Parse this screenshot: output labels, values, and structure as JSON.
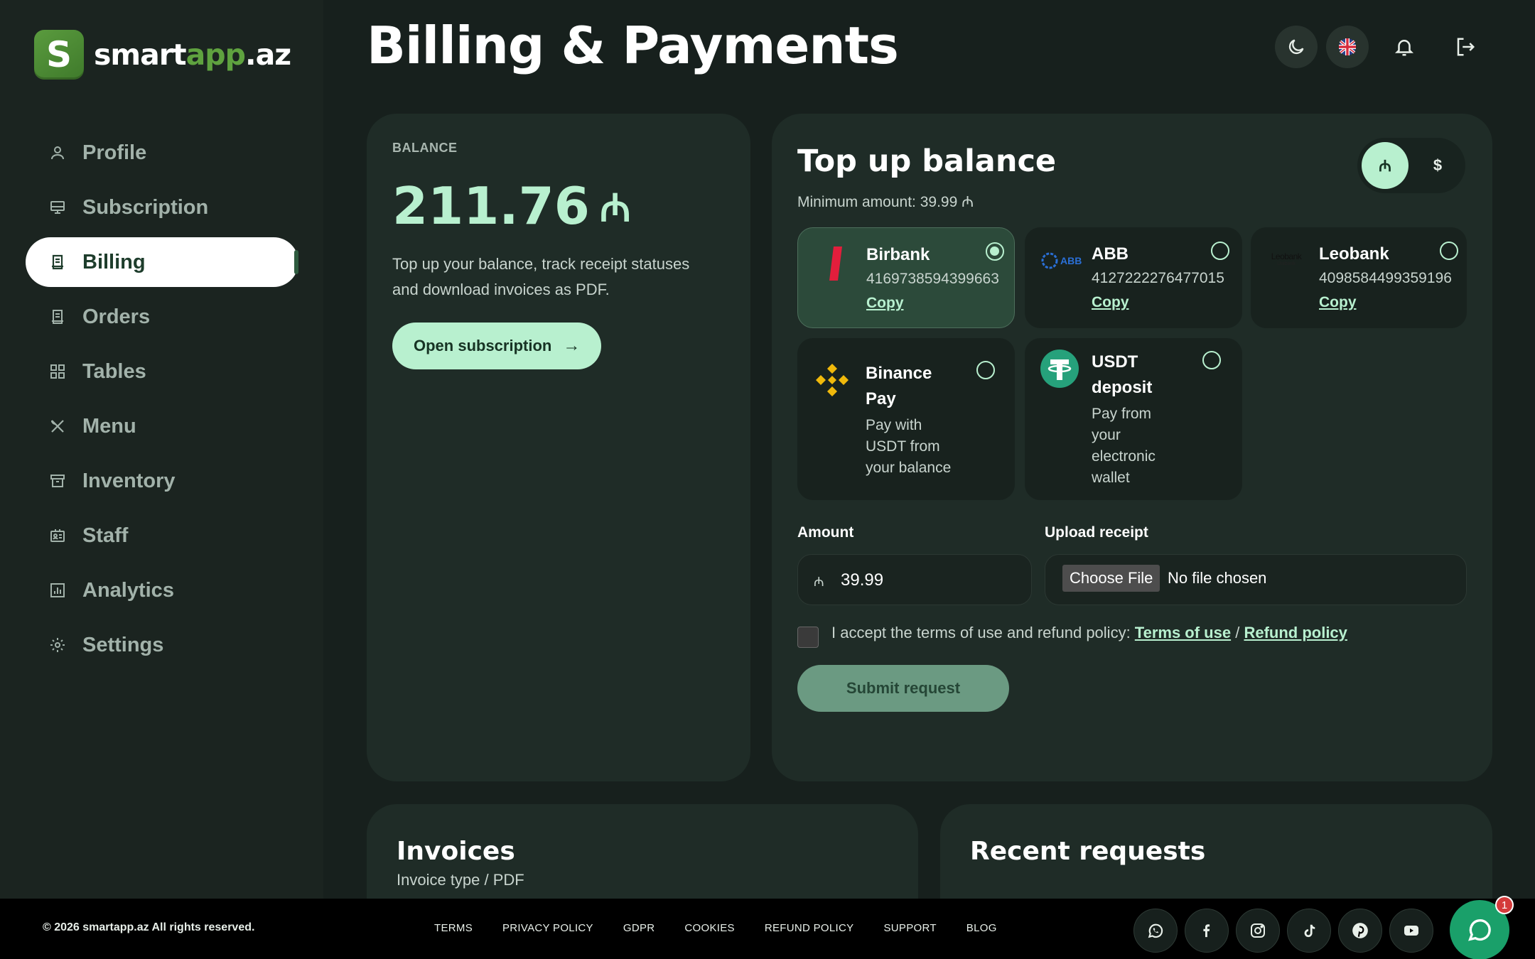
{
  "brand": {
    "name_main": "smart",
    "name_accent": "app",
    "name_suffix": ".az",
    "mark_letter": "S",
    "color_accent": "#5fa23f"
  },
  "sidebar": {
    "items": [
      {
        "label": "Profile",
        "icon": "user-icon"
      },
      {
        "label": "Subscription",
        "icon": "monitor-icon"
      },
      {
        "label": "Billing",
        "icon": "receipt-icon",
        "active": true
      },
      {
        "label": "Orders",
        "icon": "clipboard-icon"
      },
      {
        "label": "Tables",
        "icon": "grid-icon"
      },
      {
        "label": "Menu",
        "icon": "utensils-icon"
      },
      {
        "label": "Inventory",
        "icon": "archive-icon"
      },
      {
        "label": "Staff",
        "icon": "id-card-icon"
      },
      {
        "label": "Analytics",
        "icon": "bar-chart-icon"
      },
      {
        "label": "Settings",
        "icon": "gear-icon"
      }
    ]
  },
  "header": {
    "title": "Billing & Payments"
  },
  "balance": {
    "label": "BALANCE",
    "amount": "211.76",
    "currency": "₼",
    "description": "Top up your balance, track receipt statuses and download invoices as PDF.",
    "open_button": "Open subscription"
  },
  "topup": {
    "title": "Top up balance",
    "minimum": "Minimum amount: 39.99 ₼",
    "currency_options": [
      "₼",
      "$"
    ],
    "methods": [
      {
        "name": "Birbank",
        "number": "4169738594399663",
        "copy": "Copy",
        "selected": true
      },
      {
        "name": "ABB",
        "number": "4127222276477015",
        "copy": "Copy",
        "logo_text": "ABB"
      },
      {
        "name": "Leobank",
        "number": "4098584499359196",
        "copy": "Copy",
        "logo_text": "Leobank",
        "logo_sub": "Unibank"
      },
      {
        "name_line1": "Binance",
        "name_line2": "Pay",
        "desc_lines": [
          "Pay with",
          "USDT from",
          "your balance"
        ]
      },
      {
        "name_line1": "USDT",
        "name_line2": "deposit",
        "desc_lines": [
          "Pay from",
          "your",
          "electronic",
          "wallet"
        ]
      }
    ],
    "amount_label": "Amount",
    "amount_currency": "₼",
    "amount_value": "39.99",
    "upload_label": "Upload receipt",
    "choose_file": "Choose File",
    "no_file": "No file chosen",
    "terms_text": "I accept the terms of use and refund policy: ",
    "terms_link": "Terms of use",
    "terms_sep": " / ",
    "refund_link": "Refund policy",
    "submit": "Submit request"
  },
  "invoices": {
    "title": "Invoices",
    "subtitle": "Invoice type / PDF"
  },
  "requests": {
    "title": "Recent requests"
  },
  "footer": {
    "copyright": "© 2026 smartapp.az All rights reserved.",
    "links": [
      "TERMS",
      "PRIVACY POLICY",
      "GDPR",
      "COOKIES",
      "REFUND POLICY",
      "SUPPORT",
      "BLOG"
    ],
    "social": [
      "whatsapp-icon",
      "facebook-icon",
      "instagram-icon",
      "tiktok-icon",
      "pinterest-icon",
      "youtube-icon"
    ],
    "chat_badge": "1"
  },
  "colors": {
    "mint": "#b8f0cf",
    "bg": "#17201d",
    "card": "#1f2c27",
    "binance": "#f0b90b",
    "tether": "#26a17b"
  }
}
